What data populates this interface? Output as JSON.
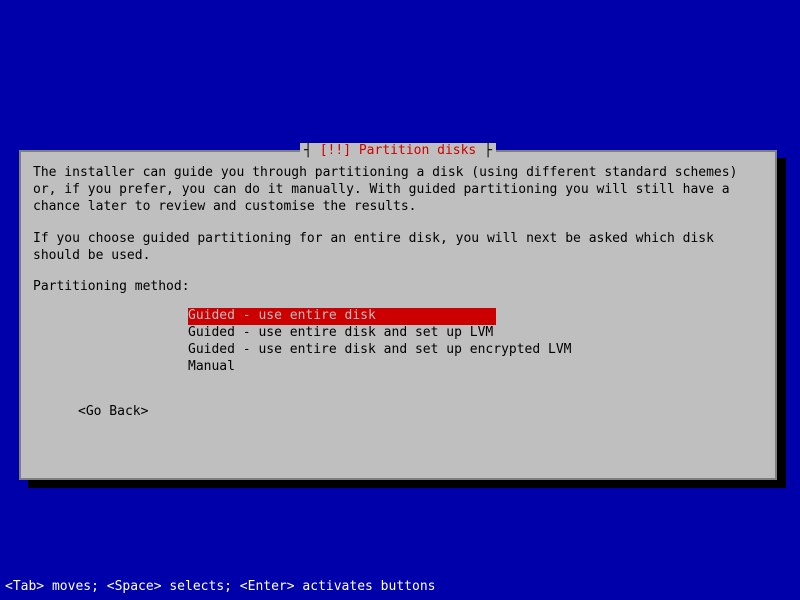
{
  "dialog": {
    "title_left": "┤ ",
    "title_marker": "[!!]",
    "title_text": " Partition disks",
    "title_right": " ├",
    "para1": "The installer can guide you through partitioning a disk (using different standard schemes) or, if you prefer, you can do it manually. With guided partitioning you will still have a chance later to review and customise the results.",
    "para2": "If you choose guided partitioning for an entire disk, you will next be asked which disk should be used.",
    "prompt": "Partitioning method:",
    "options": [
      "Guided - use entire disk",
      "Guided - use entire disk and set up LVM",
      "Guided - use entire disk and set up encrypted LVM",
      "Manual"
    ],
    "go_back": "<Go Back>"
  },
  "footer": "<Tab> moves; <Space> selects; <Enter> activates buttons"
}
